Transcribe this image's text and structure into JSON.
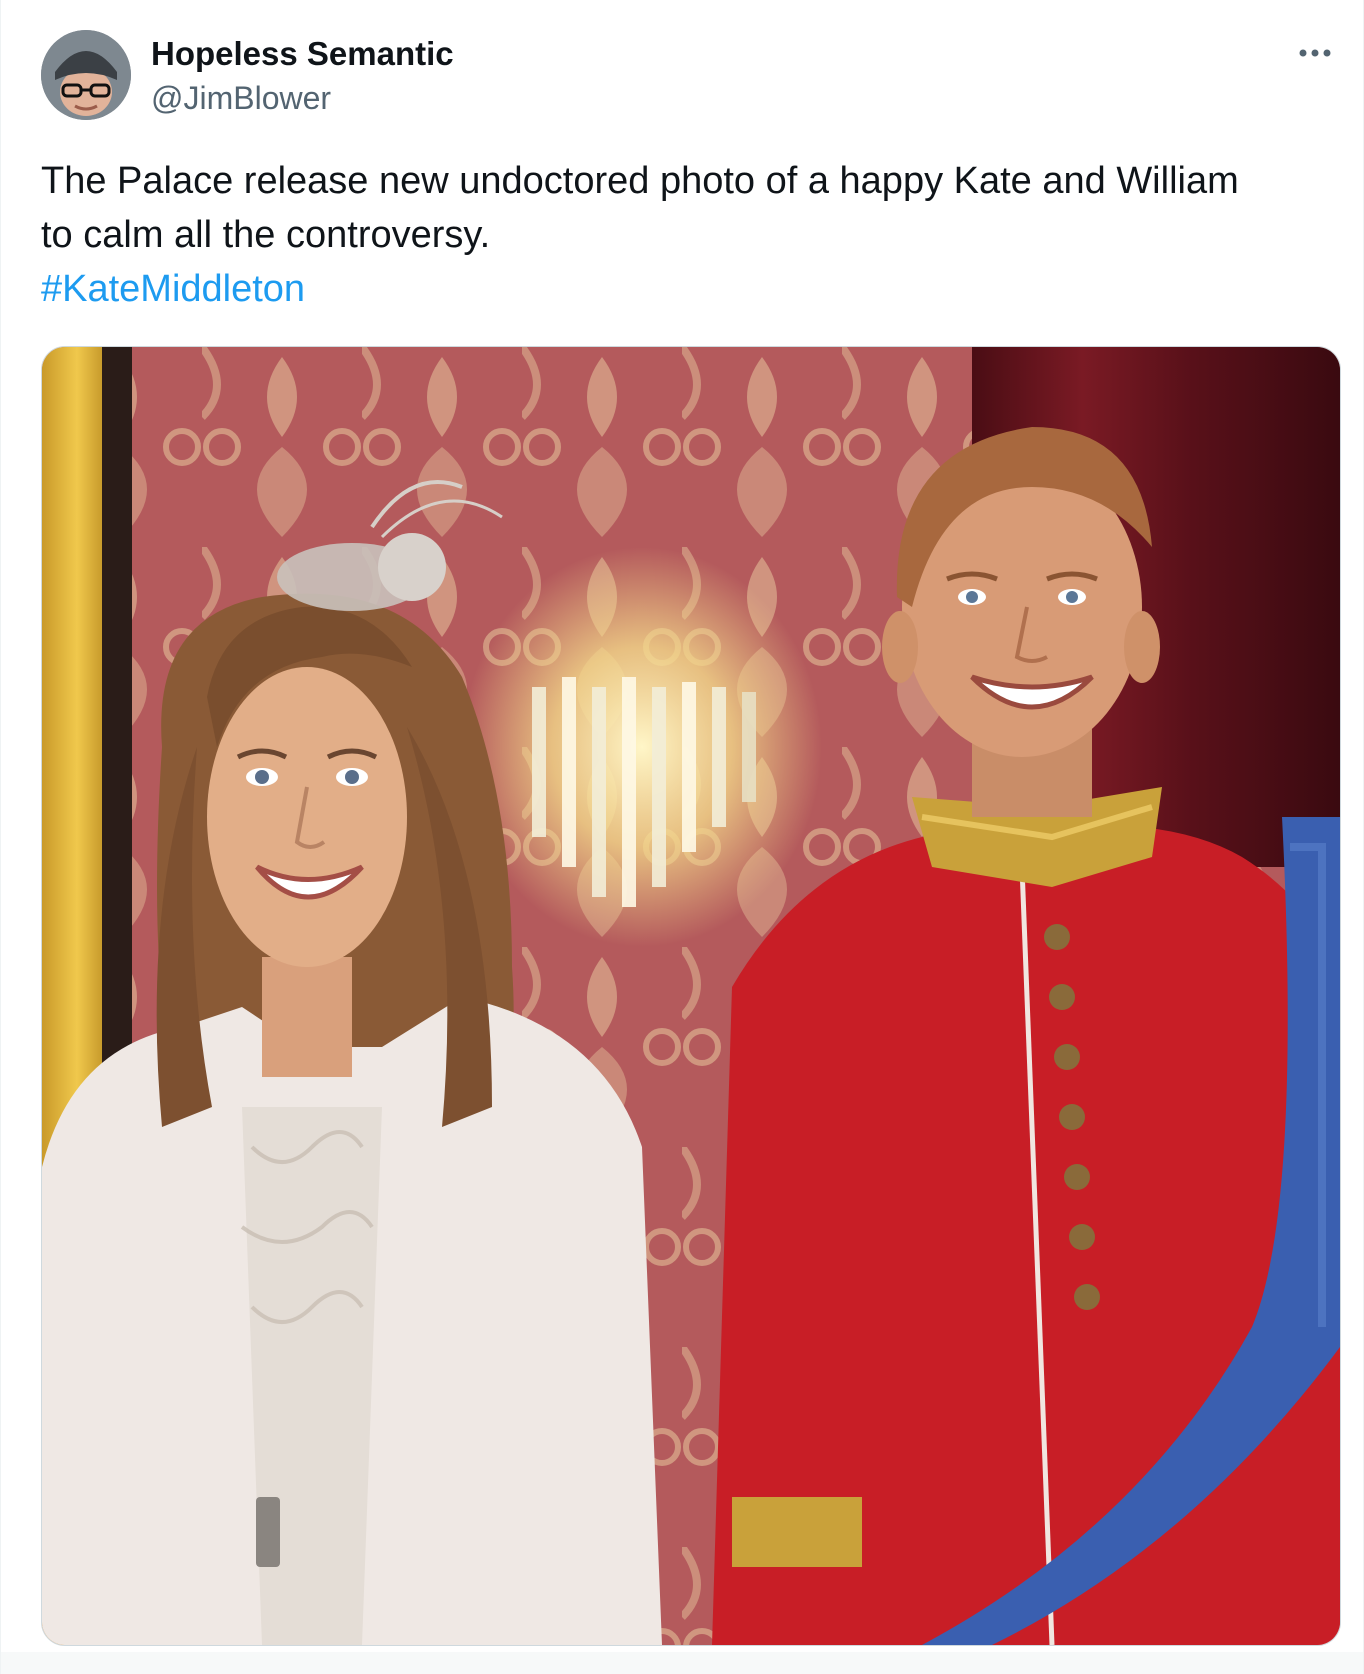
{
  "tweet": {
    "author": {
      "display_name": "Hopeless Semantic",
      "handle": "@JimBlower",
      "avatar_icon": "user-avatar"
    },
    "more_icon": "more-horizontal-icon",
    "text_lines": [
      "The Palace release new undoctored photo of a happy Kate and William",
      "to calm all the controversy."
    ],
    "hashtag": "#KateMiddleton",
    "colors": {
      "text": "#0f1419",
      "secondary": "#536471",
      "link": "#1d9bf0",
      "border": "#cfd9de"
    }
  }
}
